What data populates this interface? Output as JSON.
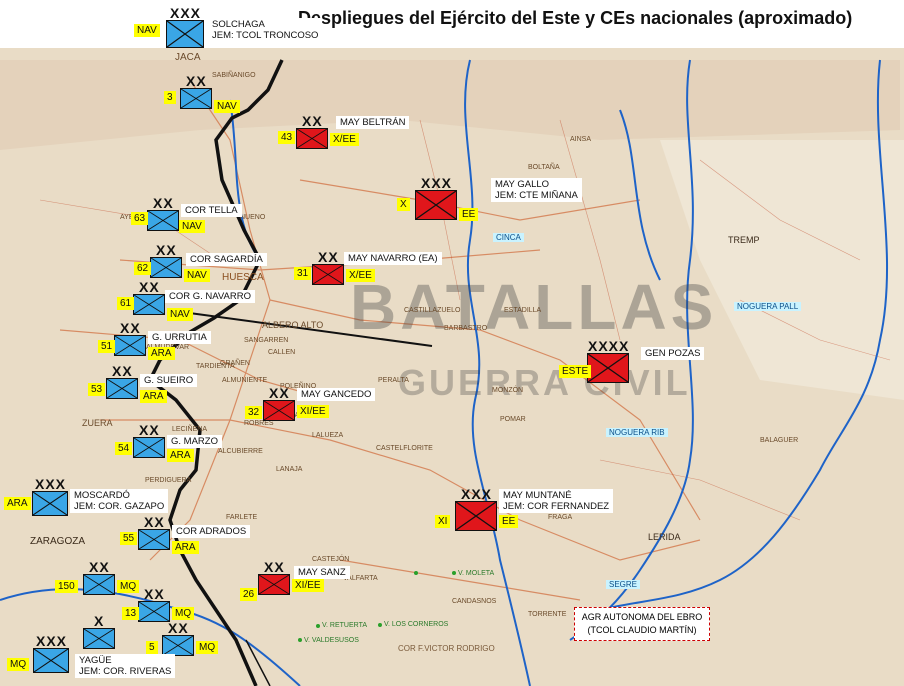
{
  "title": "Despliegues del Ejército del Este y CEs nacionales (aproximado)",
  "watermark": {
    "line1": "BATALLAS",
    "line2": "GUERRA CIVIL"
  },
  "credit": "COR F.VICTOR RODRIGO",
  "agr": {
    "line1": "AGR AUTONOMA DEL EBRO",
    "line2": "(TCOL CLAUDIO MARTÍN)"
  },
  "colors": {
    "nationalist": "#3aa6e6",
    "republican": "#e0161b",
    "tag": "#ffff00"
  },
  "units": [
    {
      "id": "solchaga",
      "side": "nationalist",
      "echelon": "XXX",
      "left_tag": "NAV",
      "right_tag": "",
      "label1": "SOLCHAGA",
      "label2": "JEM: TCOL TRONCOSO"
    },
    {
      "id": "div3",
      "side": "nationalist",
      "echelon": "XX",
      "left_tag": "3",
      "right_tag": "NAV",
      "label1": "",
      "label2": ""
    },
    {
      "id": "beltran",
      "side": "republican",
      "echelon": "XX",
      "left_tag": "43",
      "right_tag": "X/EE",
      "label1": "MAY BELTRÁN",
      "label2": ""
    },
    {
      "id": "gallo",
      "side": "republican",
      "echelon": "XXX",
      "left_tag": "X",
      "right_tag": "EE",
      "label1": "MAY GALLO",
      "label2": "JEM: CTE MIÑANA"
    },
    {
      "id": "tella",
      "side": "nationalist",
      "echelon": "XX",
      "left_tag": "63",
      "right_tag": "NAV",
      "label1": "COR TELLA",
      "label2": ""
    },
    {
      "id": "sagardia",
      "side": "nationalist",
      "echelon": "XX",
      "left_tag": "62",
      "right_tag": "NAV",
      "label1": "COR SAGARDÍA",
      "label2": ""
    },
    {
      "id": "navarro",
      "side": "republican",
      "echelon": "XX",
      "left_tag": "31",
      "right_tag": "X/EE",
      "label1": "MAY NAVARRO (EA)",
      "label2": ""
    },
    {
      "id": "gnavarro",
      "side": "nationalist",
      "echelon": "XX",
      "left_tag": "61",
      "right_tag": "NAV",
      "label1": "COR G. NAVARRO",
      "label2": ""
    },
    {
      "id": "urrutia",
      "side": "nationalist",
      "echelon": "XX",
      "left_tag": "51",
      "right_tag": "ARA",
      "label1": "G. URRUTIA",
      "label2": ""
    },
    {
      "id": "pozas",
      "side": "republican",
      "echelon": "XXXX",
      "left_tag": "ESTE",
      "right_tag": "",
      "label1": "GEN POZAS",
      "label2": ""
    },
    {
      "id": "sueiro",
      "side": "nationalist",
      "echelon": "XX",
      "left_tag": "53",
      "right_tag": "ARA",
      "label1": "G. SUEIRO",
      "label2": ""
    },
    {
      "id": "gancedo",
      "side": "republican",
      "echelon": "XX",
      "left_tag": "32",
      "right_tag": "XI/EE",
      "label1": "MAY GANCEDO",
      "label2": ""
    },
    {
      "id": "marzo",
      "side": "nationalist",
      "echelon": "XX",
      "left_tag": "54",
      "right_tag": "ARA",
      "label1": "G. MARZO",
      "label2": ""
    },
    {
      "id": "moscardo",
      "side": "nationalist",
      "echelon": "XXX",
      "left_tag": "ARA",
      "right_tag": "",
      "label1": "MOSCARDÓ",
      "label2": "JEM: COR. GAZAPO"
    },
    {
      "id": "muntane",
      "side": "republican",
      "echelon": "XXX",
      "left_tag": "XI",
      "right_tag": "EE",
      "label1": "MAY MUNTANÉ",
      "label2": "JEM: COR FERNANDEZ"
    },
    {
      "id": "adrados",
      "side": "nationalist",
      "echelon": "XX",
      "left_tag": "55",
      "right_tag": "ARA",
      "label1": "COR  ADRADOS",
      "label2": ""
    },
    {
      "id": "sanz",
      "side": "republican",
      "echelon": "XX",
      "left_tag": "26",
      "right_tag": "XI/EE",
      "label1": "MAY SANZ",
      "label2": ""
    },
    {
      "id": "div150",
      "side": "nationalist",
      "echelon": "XX",
      "left_tag": "150",
      "right_tag": "MQ",
      "label1": "",
      "label2": ""
    },
    {
      "id": "div13",
      "side": "nationalist",
      "echelon": "XX",
      "left_tag": "13",
      "right_tag": "MQ",
      "label1": "",
      "label2": ""
    },
    {
      "id": "brig",
      "side": "nationalist",
      "echelon": "X",
      "left_tag": "",
      "right_tag": "",
      "label1": "",
      "label2": ""
    },
    {
      "id": "div5",
      "side": "nationalist",
      "echelon": "XX",
      "left_tag": "5",
      "right_tag": "MQ",
      "label1": "",
      "label2": ""
    },
    {
      "id": "yague",
      "side": "nationalist",
      "echelon": "XXX",
      "left_tag": "MQ",
      "right_tag": "",
      "label1": "YAGÜE",
      "label2": "JEM: COR. RIVERAS"
    }
  ],
  "places": [
    "JACA",
    "SABIÑANIGO",
    "HUESCA",
    "ALBERO ALTO",
    "ZUERA",
    "ZARAGOZA",
    "LERIDA",
    "TREMP",
    "BALAGUER",
    "ESTADILLA",
    "CASTILLAZUELO",
    "MONZÓN",
    "BARBASTRO",
    "FRAGA",
    "CASTEJÓN",
    "VALFARTA",
    "CANDASNOS",
    "TORRENTE",
    "V. MOLETA",
    "V. RETUERTA",
    "V. LOS CORNEROS",
    "V. VALDESUSOS",
    "PERDIGUERA",
    "LANAJA",
    "FARLETE",
    "ALCUBIERRE",
    "SARIÑENA",
    "GRAÑEN",
    "TARDIENTA",
    "ALMUDEVAR",
    "ROBRES",
    "SANGARREN",
    "CALLEN",
    "PERALTA",
    "AYERBE",
    "NUENO",
    "BOLTAÑA",
    "POMAR",
    "ALMUNIENTE",
    "LALUEZA",
    "CASTELFLORITE",
    "POLEÑINO",
    "LECIÑENA",
    "AINSA"
  ],
  "rivers": {
    "cinca": "CINCA",
    "segre": "SEGRE",
    "noguera_pall": "NOGUERA PALL",
    "noguera_rib": "NOGUERA RIB"
  }
}
